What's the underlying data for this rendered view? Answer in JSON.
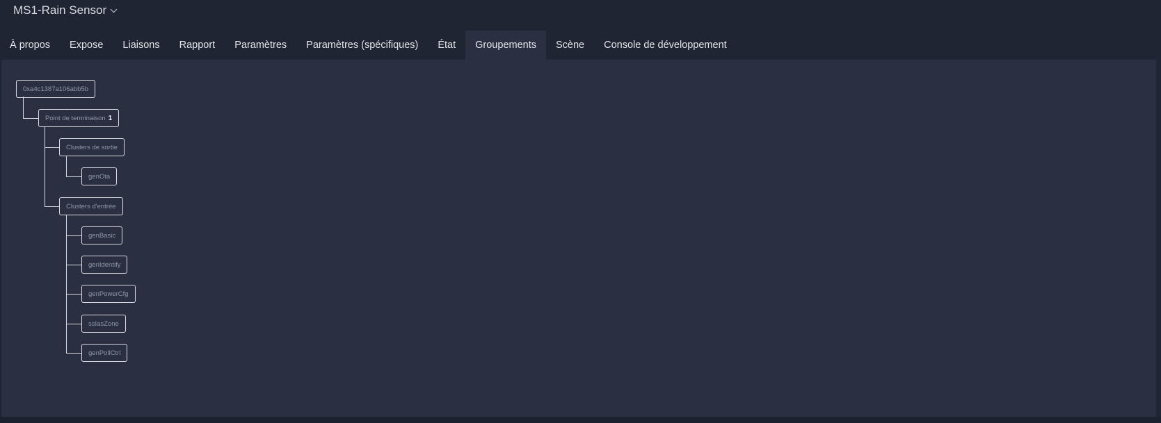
{
  "header": {
    "device_name": "MS1-Rain Sensor"
  },
  "tabs": [
    {
      "label": "À propos",
      "active": false
    },
    {
      "label": "Expose",
      "active": false
    },
    {
      "label": "Liaisons",
      "active": false
    },
    {
      "label": "Rapport",
      "active": false
    },
    {
      "label": "Paramètres",
      "active": false
    },
    {
      "label": "Paramètres (spécifiques)",
      "active": false
    },
    {
      "label": "État",
      "active": false
    },
    {
      "label": "Groupements",
      "active": true
    },
    {
      "label": "Scène",
      "active": false
    },
    {
      "label": "Console de développement",
      "active": false
    }
  ],
  "tree": {
    "device_address": "0xa4c1387a106abb5b",
    "endpoint": {
      "label": "Point de terminaison",
      "number": "1"
    },
    "output_clusters": {
      "label": "Clusters de sortie",
      "items": [
        "genOta"
      ]
    },
    "input_clusters": {
      "label": "Clusters d'entrée",
      "items": [
        "genBasic",
        "genIdentify",
        "genPowerCfg",
        "ssIasZone",
        "genPollCtrl"
      ]
    }
  },
  "colors": {
    "background": "#1f2532",
    "panel": "#2a3042",
    "node_border": "#d9dde3",
    "node_text": "#8f97a6",
    "tab_text": "#e2e5ea"
  }
}
